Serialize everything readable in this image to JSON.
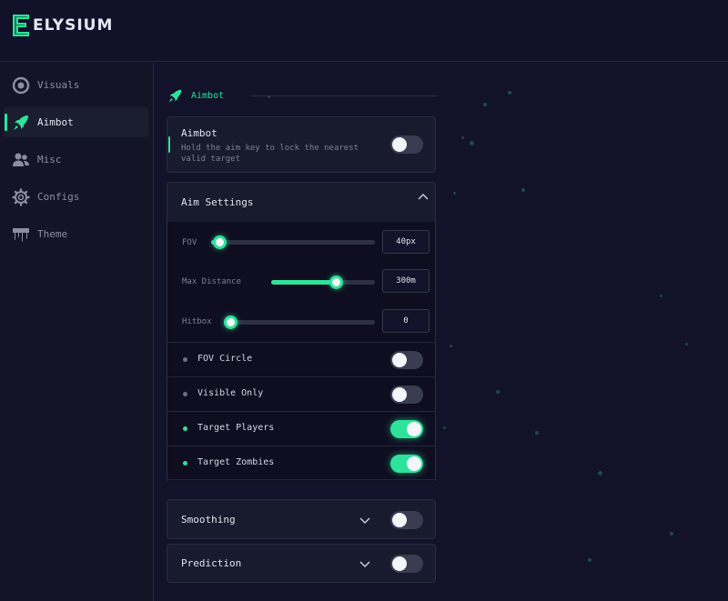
{
  "brand": {
    "name": "ELYSIUM",
    "accent": "#2de39b"
  },
  "sidebar": {
    "items": [
      {
        "label": "Visuals",
        "icon": "eye-icon",
        "active": false
      },
      {
        "label": "Aimbot",
        "icon": "rocket-icon",
        "active": true
      },
      {
        "label": "Misc",
        "icon": "users-icon",
        "active": false
      },
      {
        "label": "Configs",
        "icon": "gear-icon",
        "active": false
      },
      {
        "label": "Theme",
        "icon": "paint-drip-icon",
        "active": false
      }
    ]
  },
  "section": {
    "title": "Aimbot",
    "icon": "rocket-icon"
  },
  "aimbot_card": {
    "title": "Aimbot",
    "description": "Hold the aim key to lock the nearest valid target",
    "enabled": false
  },
  "aim_settings": {
    "title": "Aim Settings",
    "expanded": true,
    "sliders": [
      {
        "label": "FOV",
        "value": "40px",
        "fraction": 0.03
      },
      {
        "label": "Max Distance",
        "value": "300m",
        "fraction": 0.59
      },
      {
        "label": "Hitbox",
        "value": "0",
        "fraction": 0.0
      }
    ],
    "options": [
      {
        "label": "FOV Circle",
        "enabled": false
      },
      {
        "label": "Visible Only",
        "enabled": false
      },
      {
        "label": "Target Players",
        "enabled": true
      },
      {
        "label": "Target Zombies",
        "enabled": true
      }
    ]
  },
  "smoothing": {
    "title": "Smoothing",
    "enabled": false
  },
  "prediction": {
    "title": "Prediction",
    "enabled": false
  }
}
